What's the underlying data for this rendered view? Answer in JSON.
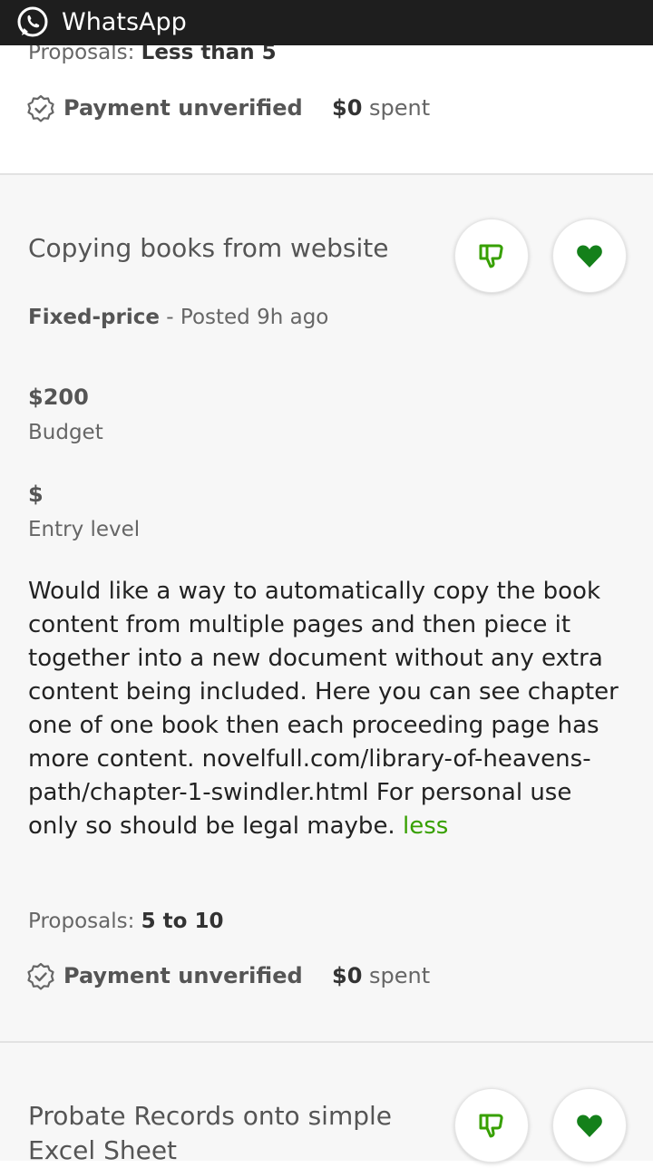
{
  "status_bar": {
    "app_name": "WhatsApp",
    "icon": "whatsapp-icon"
  },
  "previous_job": {
    "proposals_label": "Proposals:",
    "proposals_value": "Less than 5",
    "payment_label": "Payment unverified",
    "spent_amount": "$0",
    "spent_label": "spent"
  },
  "current_job": {
    "title": "Copying books from website",
    "job_type": "Fixed-price",
    "posted": "- Posted 9h ago",
    "budget_value": "$200",
    "budget_label": "Budget",
    "level_value": "$",
    "level_label": "Entry level",
    "description": "Would like a way to automatically copy the book content from multiple pages and then piece it together into a new document without any extra content being included. Here you can see chapter one of one book then each proceeding page has more content. novelfull.com/library-of-heavens-path/chapter-1-swindler.html For personal use only so should be legal maybe.",
    "less_link": "less",
    "proposals_label": "Proposals:",
    "proposals_value": "5 to 10",
    "payment_label": "Payment unverified",
    "spent_amount": "$0",
    "spent_label": "spent"
  },
  "next_job": {
    "title_line1": "Probate Records onto simple",
    "title_line2": "Excel Sheet"
  },
  "icons": {
    "dislike": "thumbs-down-icon",
    "save": "heart-icon",
    "payment": "verified-badge-icon"
  },
  "colors": {
    "status_bar": "#1e1e1e",
    "accent_green": "#37a000",
    "heart_green": "#14801a",
    "card_background": "#f7f7f7"
  }
}
